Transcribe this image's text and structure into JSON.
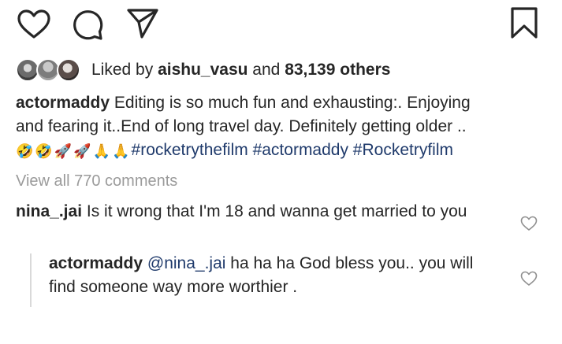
{
  "actions": {
    "like_icon": "heart-icon",
    "comment_icon": "comment-icon",
    "share_icon": "paper-plane-icon",
    "save_icon": "bookmark-icon"
  },
  "likes": {
    "prefix": "Liked by ",
    "user": "aishu_vasu",
    "middle": " and ",
    "count": "83,139 others"
  },
  "caption": {
    "user": "actormaddy",
    "line1": " Editing is so much fun and exhausting:. Enjoying",
    "line2": "and fearing it..End of long travel day. Definitely getting older ..",
    "emojis": [
      "🤣",
      "🤣",
      "🚀",
      "🚀",
      "🙏",
      "🙏"
    ],
    "hashtags": "#rocketrythefilm #actormaddy #Rocketryfilm"
  },
  "view_all": "View all 770 comments",
  "comment": {
    "user": "nina_.jai",
    "text": " Is it wrong that I'm 18 and wanna get married to you"
  },
  "reply": {
    "user": "actormaddy",
    "mention": "@nina_.jai",
    "text": " ha ha ha God bless you.. you will find someone way more worthier ."
  },
  "colors": {
    "text": "#262626",
    "hashtag": "#1f3a6b",
    "muted": "#9b9b9b"
  }
}
